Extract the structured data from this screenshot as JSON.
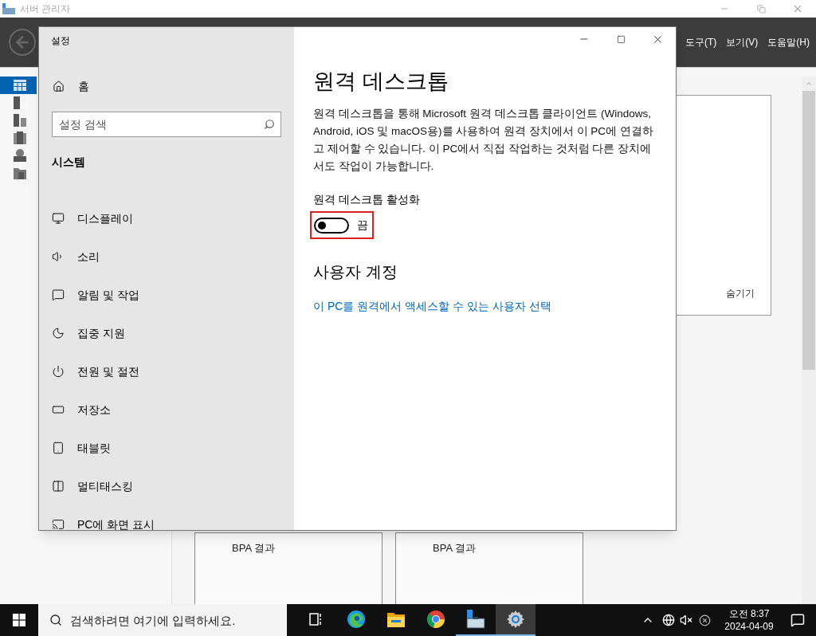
{
  "app_window": {
    "title": "서버 관리자",
    "menu": [
      "도구(T)",
      "보기(V)",
      "도움말(H)"
    ],
    "sidebar_items": [
      {
        "kind": "dashboard",
        "selected": true
      },
      {
        "kind": "server",
        "selected": false
      },
      {
        "kind": "servers",
        "selected": false
      },
      {
        "kind": "role",
        "selected": false
      },
      {
        "kind": "dns",
        "selected": false
      },
      {
        "kind": "files",
        "selected": false
      }
    ],
    "tile_link": "숨기기",
    "bpa_tiles": [
      "BPA 결과",
      "BPA 결과"
    ]
  },
  "settings": {
    "title": "설정",
    "home": "홈",
    "search": {
      "placeholder": "설정 검색"
    },
    "section": "시스템",
    "nav": [
      {
        "label": "디스플레이",
        "kind": "display"
      },
      {
        "label": "소리",
        "kind": "sound"
      },
      {
        "label": "알림 및 작업",
        "kind": "notifications"
      },
      {
        "label": "집중 지원",
        "kind": "focus"
      },
      {
        "label": "전원 및 절전",
        "kind": "power"
      },
      {
        "label": "저장소",
        "kind": "storage"
      },
      {
        "label": "태블릿",
        "kind": "tablet"
      },
      {
        "label": "멀티태스킹",
        "kind": "multitasking"
      },
      {
        "label": "PC에 화면 표시",
        "kind": "project"
      }
    ],
    "page": {
      "heading": "원격 데스크톱",
      "description": "원격 데스크톱을 통해 Microsoft 원격 데스크톱 클라이언트 (Windows, Android, iOS 및 macOS용)를 사용하여 원격 장치에서 이 PC에 연결하고 제어할 수 있습니다. 이 PC에서 직접 작업하는 것처럼 다른 장치에서도 작업이 가능합니다.",
      "toggle": {
        "label": "원격 데스크톱 활성화",
        "on": false,
        "state_text": "끔",
        "highlighted": true
      },
      "subheading": "사용자 계정",
      "link": "이 PC를 원격에서 액세스할 수 있는 사용자 선택"
    }
  },
  "taskbar": {
    "search": {
      "placeholder": "검색하려면 여기에 입력하세요."
    },
    "apps": [
      {
        "kind": "taskview",
        "running": false,
        "selected": false
      },
      {
        "kind": "edge",
        "running": false,
        "selected": false
      },
      {
        "kind": "explorer",
        "running": false,
        "selected": false
      },
      {
        "kind": "chrome",
        "running": false,
        "selected": false
      },
      {
        "kind": "servermanager",
        "running": true,
        "selected": false
      },
      {
        "kind": "settings",
        "running": true,
        "selected": true
      }
    ],
    "clock": {
      "time": "오전 8:37",
      "date": "2024-04-09"
    }
  }
}
